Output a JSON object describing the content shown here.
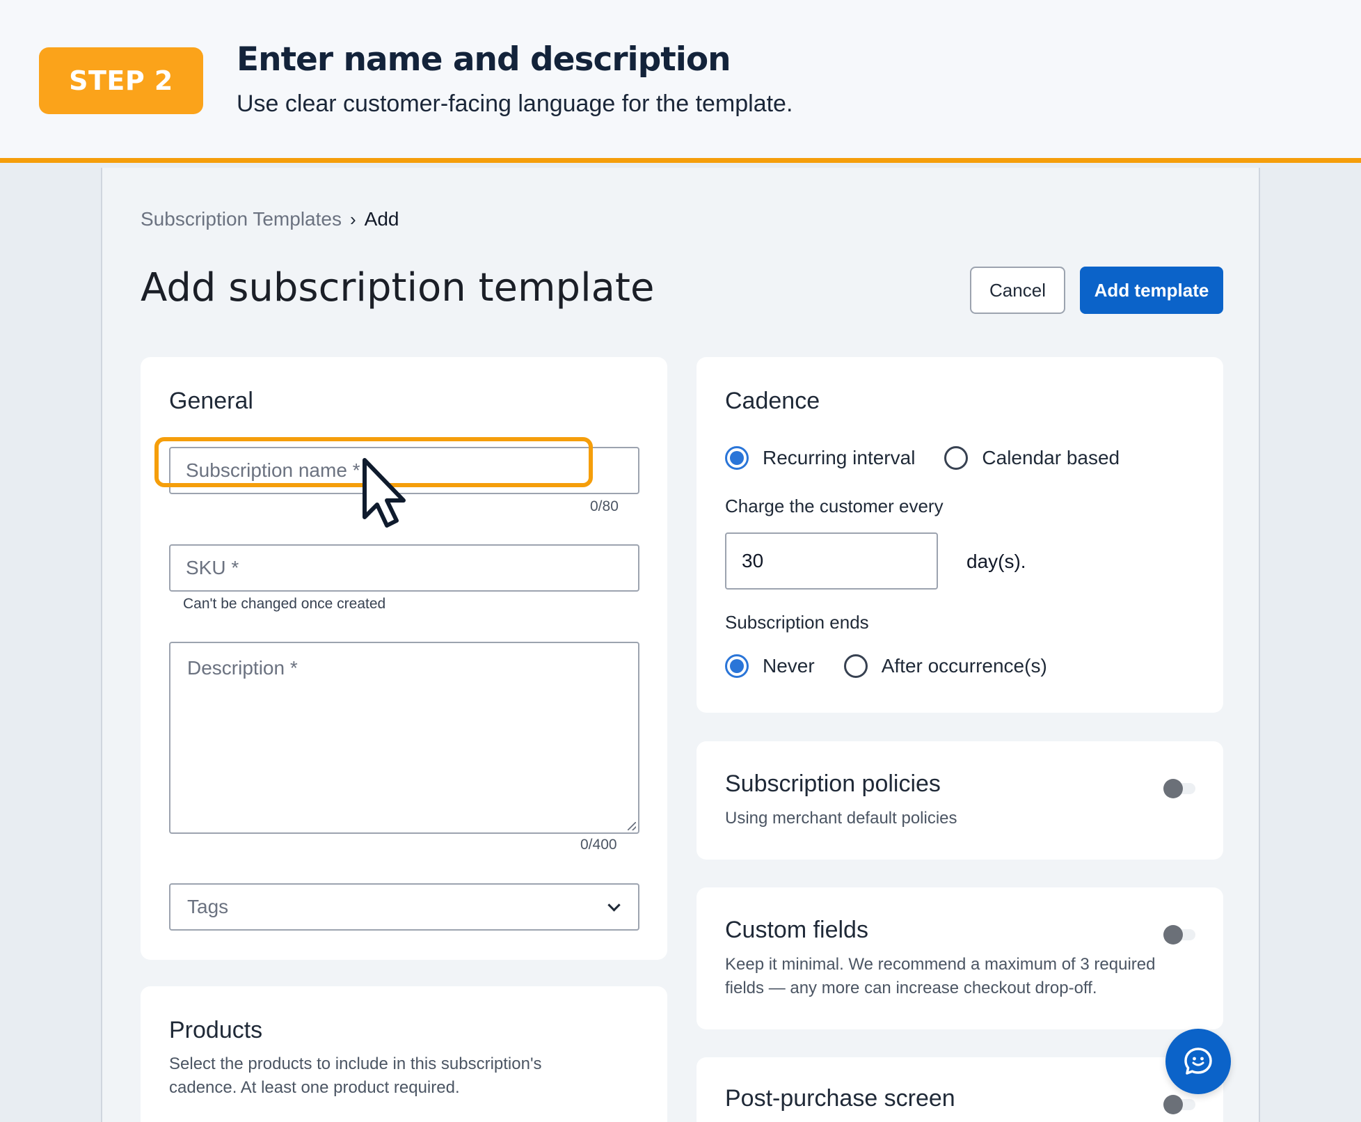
{
  "banner": {
    "step_label": "STEP 2",
    "title": "Enter name and description",
    "subtitle": "Use clear customer-facing language for the template."
  },
  "breadcrumb": {
    "parent": "Subscription Templates",
    "separator": "›",
    "current": "Add"
  },
  "page": {
    "title": "Add subscription template",
    "cancel_label": "Cancel",
    "add_label": "Add template"
  },
  "general": {
    "title": "General",
    "name_placeholder": "Subscription name *",
    "name_counter": "0/80",
    "sku_placeholder": "SKU *",
    "sku_hint": "Can't be changed once created",
    "description_placeholder": "Description *",
    "description_counter": "0/400",
    "tags_placeholder": "Tags"
  },
  "products": {
    "title": "Products",
    "description": "Select the products to include in this subscription's cadence. At least one product required."
  },
  "cadence": {
    "title": "Cadence",
    "type_options": [
      {
        "label": "Recurring interval",
        "checked": true
      },
      {
        "label": "Calendar based",
        "checked": false
      }
    ],
    "charge_label": "Charge the customer every",
    "interval_value": "30",
    "interval_unit": "day(s).",
    "ends_label": "Subscription ends",
    "ends_options": [
      {
        "label": "Never",
        "checked": true
      },
      {
        "label": "After occurrence(s)",
        "checked": false
      }
    ]
  },
  "policies": {
    "title": "Subscription policies",
    "description": "Using merchant default policies",
    "enabled": false
  },
  "custom_fields": {
    "title": "Custom fields",
    "description": "Keep it minimal. We recommend a maximum of 3 required fields — any more can increase checkout drop-off.",
    "enabled": false
  },
  "post_purchase": {
    "title": "Post-purchase screen",
    "enabled": false
  },
  "icons": {
    "cursor": "mouse-pointer-icon",
    "tags_dropdown": "chevron-down-icon",
    "chat": "chat-smiley-icon"
  },
  "colors": {
    "accent_orange": "#f59e0b",
    "primary_blue": "#0b63c9",
    "radio_blue": "#2a75d8"
  }
}
